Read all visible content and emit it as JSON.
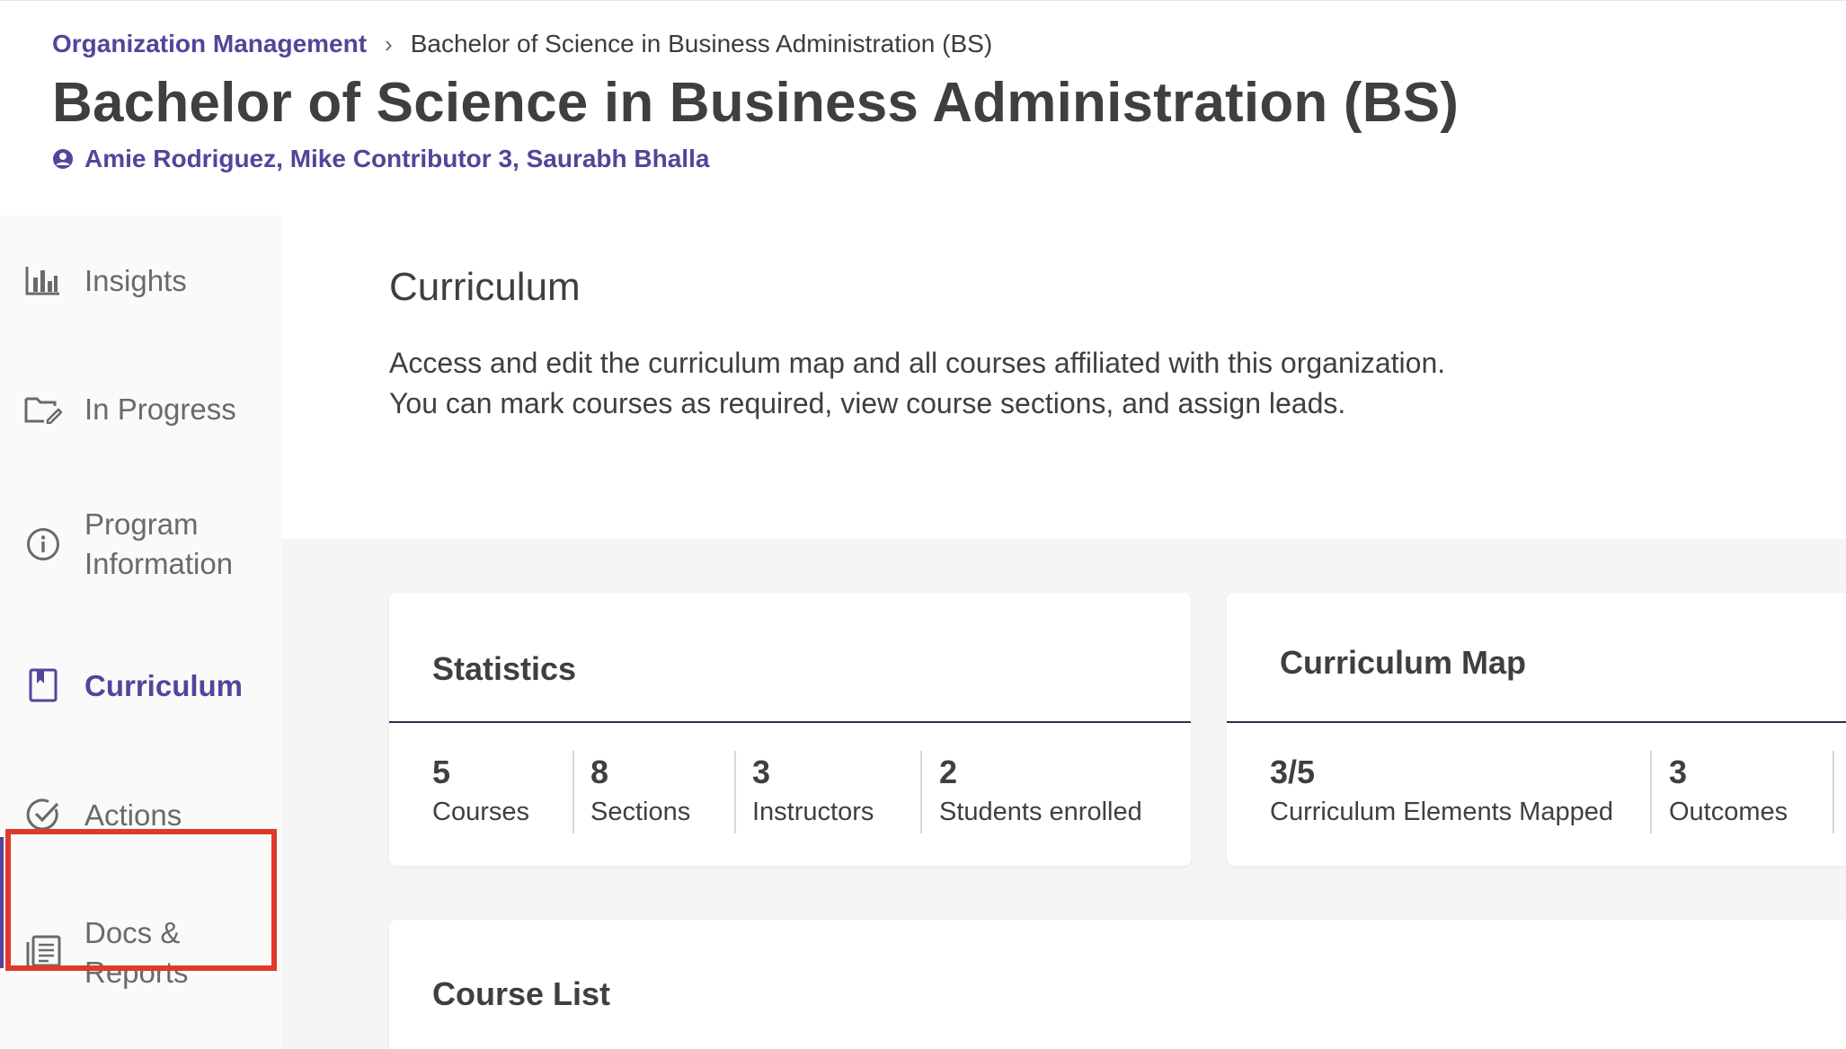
{
  "breadcrumb": {
    "parent": "Organization Management",
    "separator": "›",
    "current": "Bachelor of Science in Business Administration (BS)"
  },
  "header": {
    "title": "Bachelor of Science in Business Administration (BS)",
    "contributors": "Amie Rodriguez, Mike Contributor 3, Saurabh Bhalla"
  },
  "sidebar": {
    "items": [
      {
        "label": "Insights",
        "icon": "bar-chart-icon"
      },
      {
        "label": "In Progress",
        "icon": "folder-edit-icon"
      },
      {
        "label_line1": "Program",
        "label_line2": "Information",
        "icon": "info-icon"
      },
      {
        "label": "Curriculum",
        "icon": "bookmark-book-icon",
        "active": true
      },
      {
        "label": "Actions",
        "icon": "check-circle-icon"
      },
      {
        "label_line1": "Docs &",
        "label_line2": "Reports",
        "icon": "document-list-icon"
      }
    ]
  },
  "intro": {
    "title": "Curriculum",
    "description": "Access and edit the curriculum map and all courses affiliated with this organization. You can mark courses as required, view course sections, and assign leads."
  },
  "statistics": {
    "title": "Statistics",
    "items": [
      {
        "value": "5",
        "label": "Courses"
      },
      {
        "value": "8",
        "label": "Sections"
      },
      {
        "value": "3",
        "label": "Instructors"
      },
      {
        "value": "2",
        "label": "Students enrolled"
      }
    ]
  },
  "curriculum_map": {
    "title": "Curriculum Map",
    "items": [
      {
        "value": "3/5",
        "label": "Curriculum Elements Mapped"
      },
      {
        "value": "3",
        "label": "Outcomes"
      }
    ]
  },
  "course_list": {
    "title": "Course List"
  },
  "colors": {
    "accent": "#52459a",
    "highlight": "#e03a2a",
    "text": "#3f3f3f",
    "sidebar_bg": "#fafafa",
    "main_bg": "#f5f5f5"
  }
}
